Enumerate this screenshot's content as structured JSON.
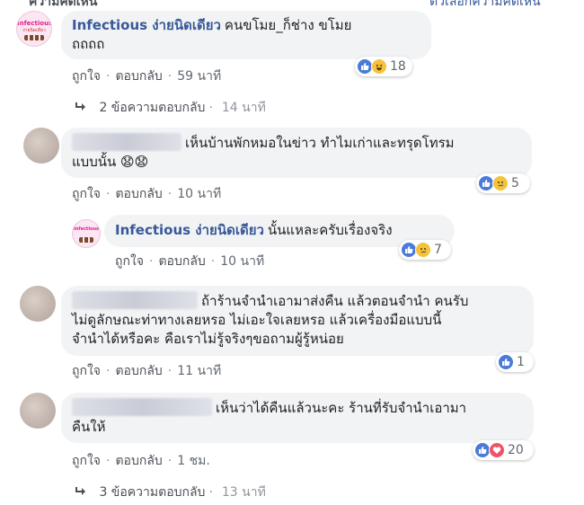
{
  "top_cut": {
    "left": "ความคิดเห็น",
    "right": "ตัวเลือกความคิดเห็น"
  },
  "comments": [
    {
      "author": "Infectious ง่ายนิดเดียว",
      "text_line1": "คนขโมย_ก็ช่าง ขโมย",
      "text_line2": "ถถถถ",
      "like": "ถูกใจ",
      "reply": "ตอบกลับ",
      "time": "59 นาที",
      "reaction_count": "18",
      "avatar_text": "Infectious",
      "avatar_subtext": "ง่ายนิดเดียว"
    },
    {
      "replies_label": "2 ข้อความตอบกลับ",
      "replies_time": "14 นาที"
    },
    {
      "text_line1": "เห็นบ้านพักหมอในข่าว ทำไมเก่าและทรุดโทรม",
      "text_line2": "แบบนั้น 😧😧",
      "like": "ถูกใจ",
      "reply": "ตอบกลับ",
      "time": "10 นาที",
      "reaction_count": "5"
    },
    {
      "author": "Infectious ง่ายนิดเดียว",
      "text_line1": "นั้นแหละครับเรื่องจริง",
      "like": "ถูกใจ",
      "reply": "ตอบกลับ",
      "time": "10 นาที",
      "reaction_count": "7"
    },
    {
      "text_line1": "ถ้าร้านจำนำเอามาส่งคืน แล้วตอนจำนำ คนรับ",
      "text_line2": "ไม่ดูลักษณะท่าทางเลยหรอ ไม่เอะใจเลยหรอ แล้วเครื่องมือแบบนี้",
      "text_line3": "จำนำได้หรือคะ คือเราไม่รู้จริงๆขอถามผู้รู้หน่อย",
      "like": "ถูกใจ",
      "reply": "ตอบกลับ",
      "time": "11 นาที",
      "reaction_count": "1"
    },
    {
      "text_line1": "เห็นว่าได้คืนแล้วนะคะ ร้านที่รับจำนำเอามา",
      "text_line2": "คืนให้",
      "like": "ถูกใจ",
      "reply": "ตอบกลับ",
      "time": "1 ชม.",
      "reaction_count": "20"
    },
    {
      "replies_label": "3 ข้อความตอบกลับ",
      "replies_time": "13 นาที"
    }
  ],
  "colors": {
    "author": "#385898",
    "bubble": "#f2f3f5",
    "meta": "#606770",
    "like_reaction": "#4a7bd9",
    "love_reaction": "#f25268",
    "emoji_reaction": "#f5c33b"
  },
  "icons": [
    "like-reaction-icon",
    "haha-reaction-icon",
    "sad-reaction-icon",
    "love-reaction-icon",
    "reply-arrow-icon"
  ]
}
